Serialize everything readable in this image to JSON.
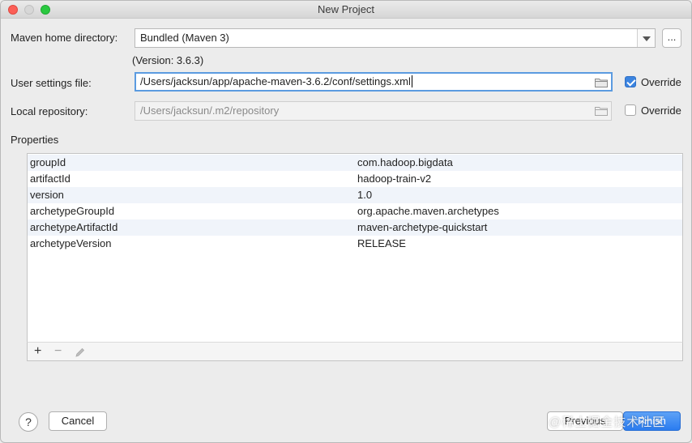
{
  "window": {
    "title": "New Project"
  },
  "maven_home": {
    "label": "Maven home directory:",
    "value": "Bundled (Maven 3)",
    "browse_label": "..."
  },
  "version_note": "(Version: 3.6.3)",
  "user_settings": {
    "label": "User settings file:",
    "value": "/Users/jacksun/app/apache-maven-3.6.2/conf/settings.xml",
    "override_label": "Override",
    "override_checked": true
  },
  "local_repo": {
    "label": "Local repository:",
    "value": "/Users/jacksun/.m2/repository",
    "override_label": "Override",
    "override_checked": false
  },
  "properties": {
    "label": "Properties",
    "rows": [
      {
        "key": "groupId",
        "value": "com.hadoop.bigdata"
      },
      {
        "key": "artifactId",
        "value": "hadoop-train-v2"
      },
      {
        "key": "version",
        "value": "1.0"
      },
      {
        "key": "archetypeGroupId",
        "value": "org.apache.maven.archetypes"
      },
      {
        "key": "archetypeArtifactId",
        "value": "maven-archetype-quickstart"
      },
      {
        "key": "archetypeVersion",
        "value": "RELEASE"
      }
    ],
    "toolbar": {
      "add": "+",
      "remove": "−"
    }
  },
  "footer": {
    "help": "?",
    "cancel": "Cancel",
    "previous": "Previous",
    "finish": "Finish",
    "watermark": "@稀土掘金技术社区"
  },
  "colors": {
    "accent": "#3b84e0",
    "focus": "#5b9be0",
    "row_alt": "#f0f4fa"
  }
}
